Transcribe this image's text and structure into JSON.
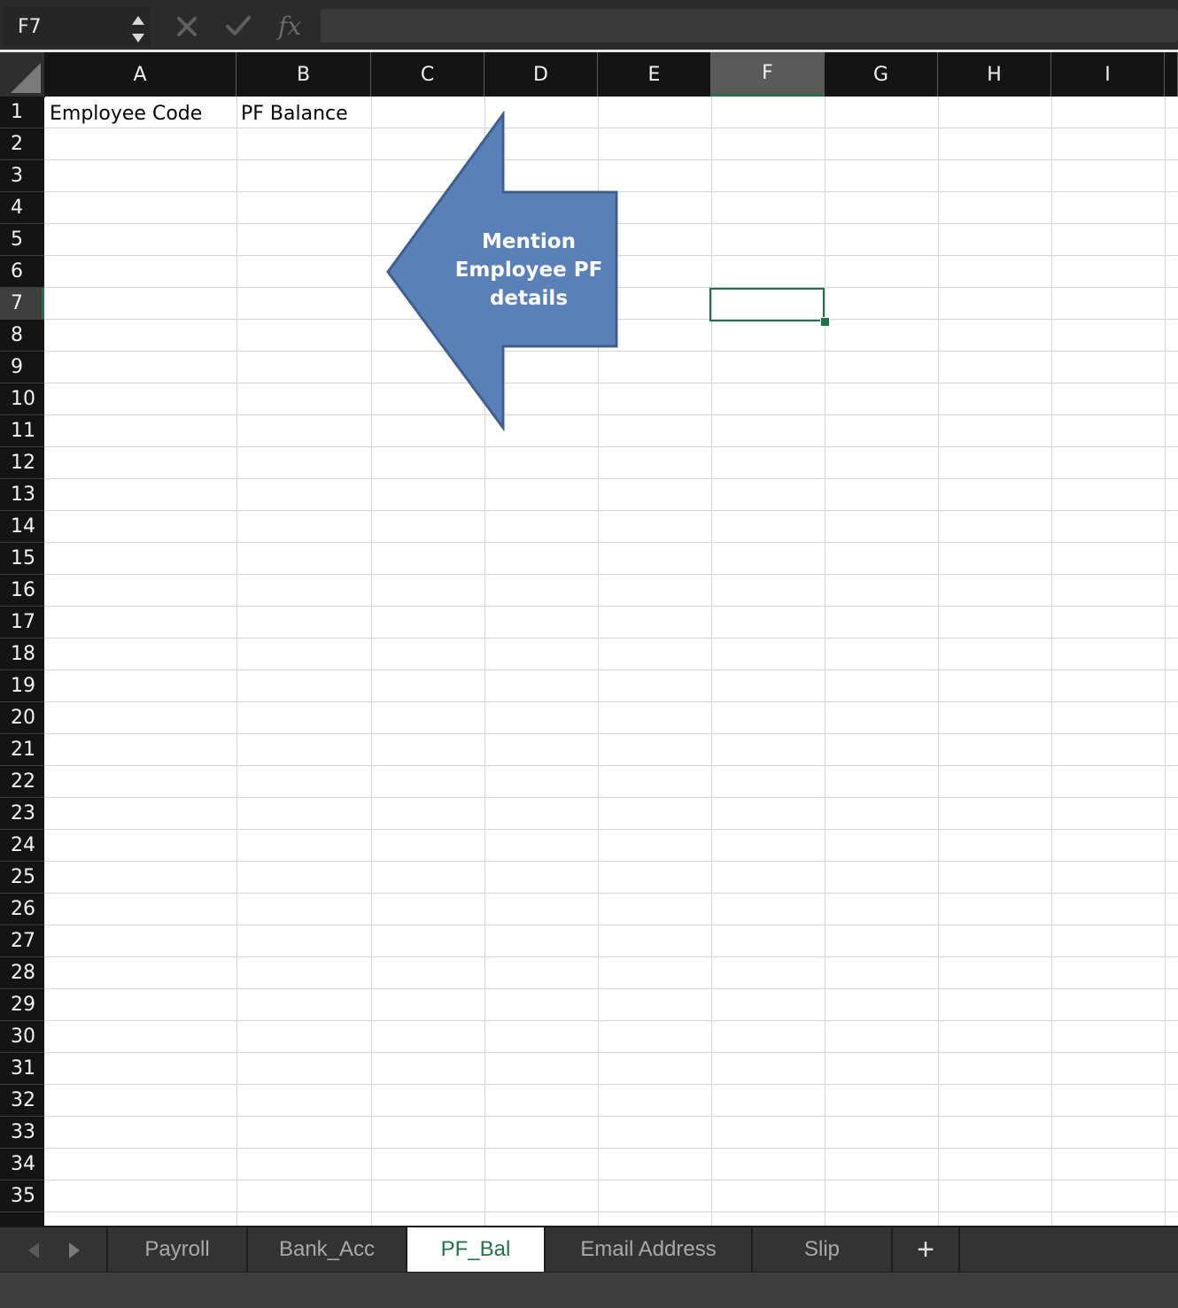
{
  "formula_bar": {
    "name_box": "F7",
    "formula": ""
  },
  "columns": [
    "A",
    "B",
    "C",
    "D",
    "E",
    "F",
    "G",
    "H",
    "I"
  ],
  "rows": [
    "1",
    "2",
    "3",
    "4",
    "5",
    "6",
    "7",
    "8",
    "9",
    "10",
    "11",
    "12",
    "13",
    "14",
    "15",
    "16",
    "17",
    "18",
    "19",
    "20",
    "21",
    "22",
    "23",
    "24",
    "25",
    "26",
    "27",
    "28",
    "29",
    "30",
    "31",
    "32",
    "33",
    "34",
    "35"
  ],
  "selected_cell": {
    "column": "F",
    "row": "7"
  },
  "cells": {
    "A1": "Employee Code",
    "B1": "PF Balance"
  },
  "callout": {
    "line1": "Mention",
    "line2": "Employee PF",
    "line3": "details",
    "fill": "#5a80b8",
    "stroke": "#3f5f8e"
  },
  "sheet_tabs": [
    "Payroll",
    "Bank_Acc",
    "PF_Bal",
    "Email Address",
    "Slip"
  ],
  "active_tab": "PF_Bal",
  "add_sheet_label": "+",
  "colors": {
    "accent": "#217346",
    "header_bg": "#141414",
    "gridline": "#d4d4d4"
  }
}
